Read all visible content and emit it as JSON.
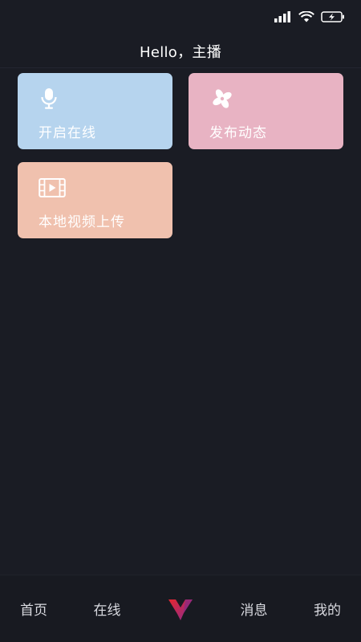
{
  "status_bar": {
    "icons": [
      "signal-icon",
      "wifi-icon",
      "battery-charging-icon"
    ]
  },
  "header": {
    "title": "Hello，主播"
  },
  "cards": [
    {
      "label": "开启在线",
      "icon": "microphone-icon",
      "color": "#b6d4ee"
    },
    {
      "label": "发布动态",
      "icon": "pinwheel-icon",
      "color": "#e8b3c3"
    },
    {
      "label": "本地视频上传",
      "icon": "film-icon",
      "color": "#f0c1ae"
    }
  ],
  "bottom_nav": {
    "items": [
      "首页",
      "在线",
      "消息",
      "我的"
    ],
    "logo_icon": "app-logo-icon",
    "logo_colors": [
      "#e5262f",
      "#8a2c90"
    ]
  },
  "colors": {
    "background": "#1a1c24",
    "nav_background": "#181a21"
  }
}
